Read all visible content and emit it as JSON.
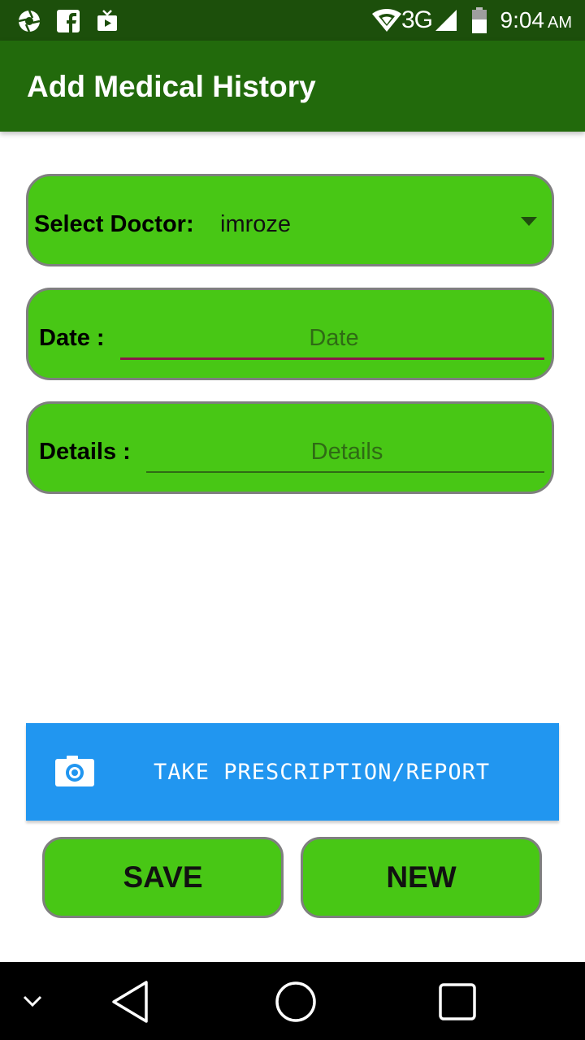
{
  "status_bar": {
    "network": "3G",
    "time": "9:04",
    "ampm": "AM",
    "icons": [
      "aperture-icon",
      "facebook-icon",
      "media-icon",
      "wifi-icon",
      "signal-icon",
      "battery-icon"
    ]
  },
  "app_bar": {
    "title": "Add Medical History"
  },
  "form": {
    "doctor_label": "Select Doctor:",
    "doctor_value": "imroze",
    "date_label": "Date :",
    "date_placeholder": "Date",
    "details_label": "Details :",
    "details_placeholder": "Details"
  },
  "camera_button": {
    "label": "TAKE PRESCRIPTION/REPORT",
    "icon": "camera-icon"
  },
  "actions": {
    "save_label": "SAVE",
    "new_label": "NEW"
  },
  "nav_bar": {
    "icons": [
      "chevron-down-icon",
      "back-icon",
      "home-icon",
      "recents-icon"
    ]
  },
  "colors": {
    "status_bar": "#1c4f0b",
    "app_bar": "#226a0c",
    "field_green": "#48c715",
    "field_border": "#7f7f7f",
    "camera_button": "#2196f0",
    "date_underline": "#8b1a4a",
    "details_underline": "#2f6b15"
  }
}
